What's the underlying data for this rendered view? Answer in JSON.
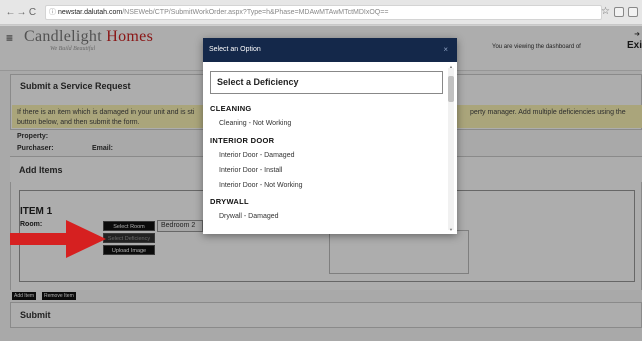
{
  "browser": {
    "back": "←",
    "forward": "→",
    "reload": "C",
    "url_icon": "ⓘ",
    "url_host": "newstar.dalutah.com",
    "url_path": "/NSEWeb/CTP/SubmitWorkOrder.aspx?Type=h&Phase=MDAwMTAwMTctMDIxOQ==",
    "star": "☆"
  },
  "header": {
    "menu_icon": "≡",
    "logo_part1": "Candlelight",
    "logo_part2": "Homes",
    "tagline": "We Build Beautiful",
    "viewing_text": "You are viewing the dashboard of",
    "exit_label": "Exi"
  },
  "form": {
    "section_title": "Submit a Service Request",
    "notice_left": "If there is an item which is damaged in your unit and is sti",
    "notice_left2": "button below, and then submit the form.",
    "notice_right": "perty manager. Add multiple deficiencies using the",
    "property_label": "Property:",
    "purchaser_label": "Purchaser:",
    "email_label": "Email:",
    "add_items_title": "Add Items",
    "item_title": "ITEM 1",
    "room_label": "Room:",
    "select_room_btn": "Select Room",
    "room_value": "Bedroom 2",
    "select_deficiency_btn": "Select Deficiency",
    "upload_btn": "Upload Image",
    "add_item_btn": "Add Item",
    "remove_item_btn": "Remove Item",
    "submit_title": "Submit"
  },
  "modal": {
    "title": "Select an Option",
    "close_icon": "×",
    "placeholder": "Select a Deficiency",
    "groups": [
      {
        "name": "CLEANING",
        "options": [
          "Cleaning - Not Working"
        ]
      },
      {
        "name": "INTERIOR DOOR",
        "options": [
          "Interior Door - Damaged",
          "Interior Door - Install",
          "Interior Door - Not Working"
        ]
      },
      {
        "name": "DRYWALL",
        "options": [
          "Drywall - Damaged"
        ]
      }
    ]
  },
  "colors": {
    "modal_header": "#14284a",
    "notice_bg": "#fbf4b6",
    "arrow": "#d62020"
  }
}
